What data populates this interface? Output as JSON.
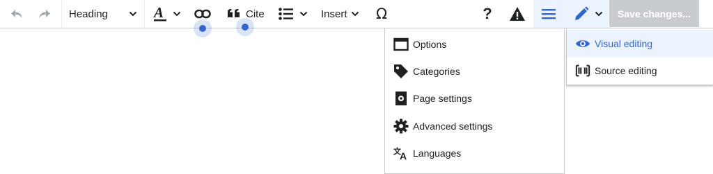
{
  "toolbar": {
    "heading_label": "Heading",
    "cite_label": "Cite",
    "insert_label": "Insert",
    "help_glyph": "?",
    "save_label": "Save changes..."
  },
  "page_menu": {
    "items": [
      {
        "label": "Options",
        "icon": "window-icon"
      },
      {
        "label": "Categories",
        "icon": "tag-icon"
      },
      {
        "label": "Page settings",
        "icon": "page-settings-icon"
      },
      {
        "label": "Advanced settings",
        "icon": "gear-icon"
      },
      {
        "label": "Languages",
        "icon": "language-icon"
      }
    ]
  },
  "edit_mode_menu": {
    "items": [
      {
        "label": "Visual editing",
        "icon": "eye-icon",
        "selected": true
      },
      {
        "label": "Source editing",
        "icon": "wikitext-brackets-icon",
        "selected": false
      }
    ]
  },
  "colors": {
    "accent": "#3366cc",
    "text": "#202122",
    "icon_gray": "#a2a9b1",
    "save_disabled_bg": "#c8ccd1",
    "selected_bg": "#eaf3ff",
    "border": "#c8ccd1"
  }
}
